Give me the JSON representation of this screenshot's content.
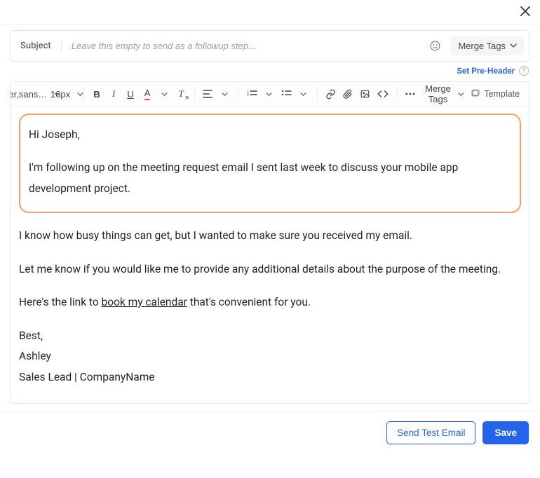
{
  "close_icon_title": "Close",
  "subject": {
    "label": "Subject",
    "placeholder": "Leave this empty to send as a followup step...",
    "value": "",
    "merge_tags_label": "Merge Tags"
  },
  "preheader": {
    "link_label": "Set Pre-Header",
    "help": "?"
  },
  "toolbar": {
    "font_family": "inter,sans…",
    "font_size": "16px",
    "merge_tags_label": "Merge Tags",
    "template_label": "Template"
  },
  "email_body": {
    "p1": "Hi Joseph,",
    "p2": "I'm following up on the meeting request email I sent last week to discuss your mobile app development project.",
    "p3": "I know how busy things can get, but I wanted to make sure you received my email.",
    "p4": "Let me know if you would like me to provide any additional details about the purpose of the meeting.",
    "p5_pre": "Here's the link to ",
    "p5_link": "book my calendar",
    "p5_post": " that's convenient for you.",
    "sig1": "Best,",
    "sig2": "Ashley",
    "sig3": "Sales Lead | CompanyName"
  },
  "footer": {
    "send_test": "Send Test Email",
    "save": "Save"
  }
}
